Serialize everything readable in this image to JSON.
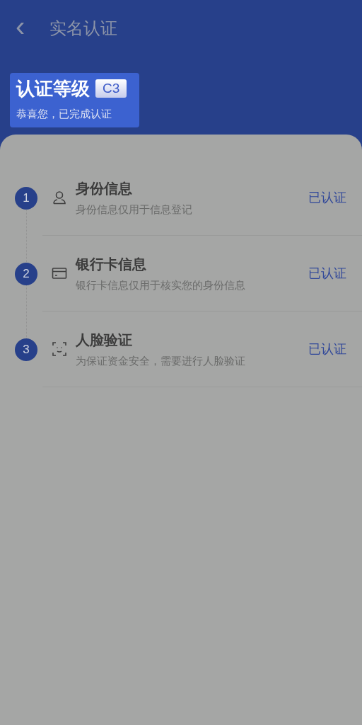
{
  "header": {
    "back_icon": "‹",
    "title": "实名认证"
  },
  "level_card": {
    "label": "认证等级",
    "level_badge": "C3",
    "message": "恭喜您，已完成认证"
  },
  "steps": [
    {
      "number": "1",
      "kind": "person",
      "title": "身份信息",
      "description": "身份信息仅用于信息登记",
      "status": "已认证"
    },
    {
      "number": "2",
      "kind": "card",
      "title": "银行卡信息",
      "description": "银行卡信息仅用于核实您的身份信息",
      "status": "已认证"
    },
    {
      "number": "3",
      "kind": "face",
      "title": "人脸验证",
      "description": "为保证资金安全，需要进行人脸验证",
      "status": "已认证"
    }
  ]
}
